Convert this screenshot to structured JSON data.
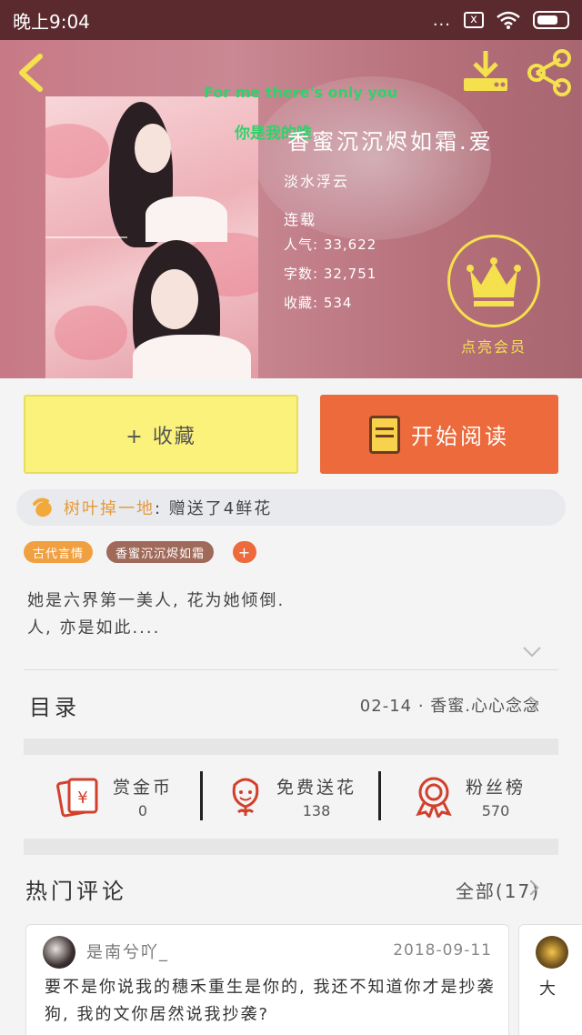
{
  "status_bar": {
    "time": "晚上9:04",
    "dots": "...",
    "sim": "x"
  },
  "book": {
    "lyric_line1": "For me there's only you",
    "lyric_line2": "你是我的唯",
    "title": "香蜜沉沉烬如霜.爱",
    "author": "淡水浮云",
    "status": "连载",
    "popularity": "人气: 33,622",
    "words": "字数: 32,751",
    "favorites": "收藏: 534",
    "vip_label": "点亮会员"
  },
  "actions": {
    "favorite": "+ 收藏",
    "read": "开始阅读"
  },
  "gift": {
    "user": "树叶掉一地",
    "message": ": 赠送了4鲜花"
  },
  "tags": [
    "古代言情",
    "香蜜沉沉烬如霜",
    "+"
  ],
  "synopsis": {
    "line1": "她是六界第一美人, 花为她倾倒.",
    "line2": "人, 亦是如此...."
  },
  "toc": {
    "label": "目录",
    "latest": "02-14 · 香蜜.心心念念"
  },
  "perks": [
    {
      "label": "赏金币",
      "value": "0"
    },
    {
      "label": "免费送花",
      "value": "138"
    },
    {
      "label": "粉丝榜",
      "value": "570"
    }
  ],
  "comments_header": {
    "title": "热门评论",
    "all": "全部(17)"
  },
  "comments": [
    {
      "user": "是南兮吖_",
      "date": "2018-09-11",
      "body": "要不是你说我的穗禾重生是你的, 我还不知道你才是抄袭狗, 我的文你居然说我抄袭?"
    },
    {
      "preview": "大"
    }
  ],
  "colors": {
    "accent_yellow": "#f5e04e",
    "read_button": "#ec6a3b",
    "fav_button": "#fbf27c",
    "lyric_green": "#33d06a"
  }
}
